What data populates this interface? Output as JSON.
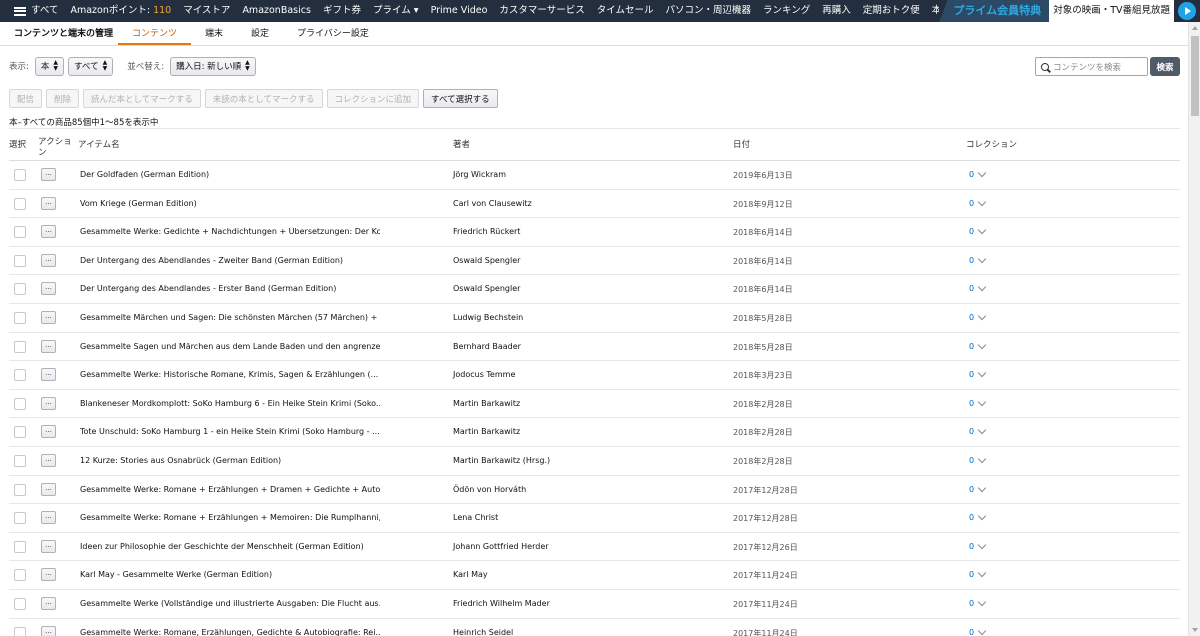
{
  "topnav": {
    "menu_label": "すべて",
    "links": [
      "Amazonポイント:",
      "マイストア",
      "AmazonBasics",
      "ギフト券",
      "プライム ▾",
      "Prime Video",
      "カスタマーサービス",
      "タイムセール",
      "パソコン・周辺機器",
      "ランキング",
      "再購入",
      "定期おトク便",
      "本"
    ],
    "points_value": "110",
    "prime_tag": "プライム会員特典",
    "prime_text": "対象の映画・TV番組見放題"
  },
  "subnav": {
    "title": "コンテンツと端末の管理",
    "tabs": [
      "コンテンツ",
      "端末",
      "設定",
      "プライバシー設定"
    ],
    "active_tab": "コンテンツ"
  },
  "filters": {
    "show_label": "表示:",
    "type_value": "本",
    "scope_value": "すべて",
    "sort_label": "並べ替え:",
    "sort_value": "購入日: 新しい順",
    "search_placeholder": "コンテンツを検索",
    "search_button": "検索"
  },
  "actions": {
    "deliver": "配信",
    "delete": "削除",
    "mark_read": "読んだ本としてマークする",
    "mark_unread": "未読の本としてマークする",
    "add_collection": "コレクションに追加",
    "select_all": "すべて選択する"
  },
  "summary": "本–すべての商品85個中1～85を表示中",
  "table": {
    "headers": {
      "select": "選択",
      "action": "アクション",
      "title": "アイテム名",
      "author": "著者",
      "date": "日付",
      "collection": "コレクション"
    },
    "action_button_label": "...",
    "rows": [
      {
        "title": "Der Goldfaden (German Edition)",
        "author": "Jörg Wickram",
        "date": "2019年6月13日",
        "collection": "0"
      },
      {
        "title": "Vom Kriege (German Edition)",
        "author": "Carl von Clausewitz",
        "date": "2018年9月12日",
        "collection": "0"
      },
      {
        "title": "Gesammelte Werke: Gedichte + Nachdichtungen + Übersetzungen: Der Ko...",
        "author": "Friedrich Rückert",
        "date": "2018年6月14日",
        "collection": "0"
      },
      {
        "title": "Der Untergang des Abendlandes - Zweiter Band (German Edition)",
        "author": "Oswald Spengler",
        "date": "2018年6月14日",
        "collection": "0"
      },
      {
        "title": "Der Untergang des Abendlandes - Erster Band (German Edition)",
        "author": "Oswald Spengler",
        "date": "2018年6月14日",
        "collection": "0"
      },
      {
        "title": "Gesammelte Märchen und Sagen: Die schönsten Märchen (57 Märchen) + ...",
        "author": "Ludwig Bechstein",
        "date": "2018年5月28日",
        "collection": "0"
      },
      {
        "title": "Gesammelte Sagen und Märchen aus dem Lande Baden und den angrenze...",
        "author": "Bernhard Baader",
        "date": "2018年5月28日",
        "collection": "0"
      },
      {
        "title": "Gesammelte Werke: Historische Romane, Krimis, Sagen & Erzählungen (...",
        "author": "Jodocus Temme",
        "date": "2018年3月23日",
        "collection": "0"
      },
      {
        "title": "Blankeneser Mordkomplott: SoKo Hamburg 6 - Ein Heike Stein Krimi (Soko...",
        "author": "Martin Barkawitz",
        "date": "2018年2月28日",
        "collection": "0"
      },
      {
        "title": "Tote Unschuld: SoKo Hamburg 1 - ein Heike Stein Krimi (Soko Hamburg - ...",
        "author": "Martin Barkawitz",
        "date": "2018年2月28日",
        "collection": "0"
      },
      {
        "title": "12 Kurze: Stories aus Osnabrück (German Edition)",
        "author": "Martin Barkawitz (Hrsg.)",
        "date": "2018年2月28日",
        "collection": "0"
      },
      {
        "title": "Gesammelte Werke: Romane + Erzählungen + Dramen + Gedichte + Auto...",
        "author": "Ödön von Horváth",
        "date": "2017年12月28日",
        "collection": "0"
      },
      {
        "title": "Gesammelte Werke: Romane + Erzählungen + Memoiren: Die Rumplhanni,...",
        "author": "Lena Christ",
        "date": "2017年12月28日",
        "collection": "0"
      },
      {
        "title": "Ideen zur Philosophie der Geschichte der Menschheit (German Edition)",
        "author": "Johann Gottfried Herder",
        "date": "2017年12月26日",
        "collection": "0"
      },
      {
        "title": "Karl May - Gesammelte Werke (German Edition)",
        "author": "Karl May",
        "date": "2017年11月24日",
        "collection": "0"
      },
      {
        "title": "Gesammelte Werke (Vollständige und illustrierte Ausgaben: Die Flucht aus...",
        "author": "Friedrich Wilhelm Mader",
        "date": "2017年11月24日",
        "collection": "0"
      },
      {
        "title": "Gesammelte Werke: Romane, Erzählungen, Gedichte & Autobiografie: Rei...",
        "author": "Heinrich Seidel",
        "date": "2017年11月24日",
        "collection": "0"
      }
    ]
  }
}
